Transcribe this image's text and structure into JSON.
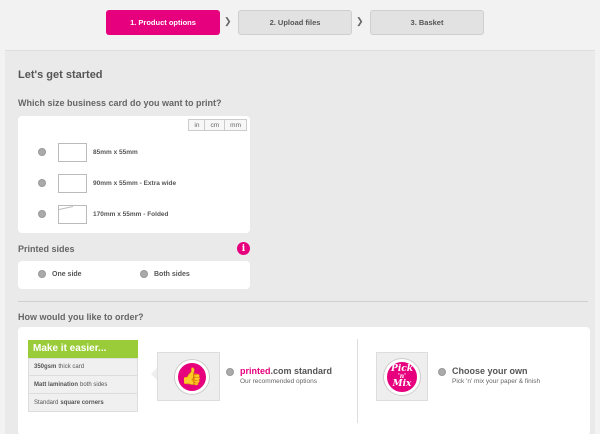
{
  "steps": [
    {
      "label": "1. Product options"
    },
    {
      "label": "2. Upload files"
    },
    {
      "label": "3. Basket"
    }
  ],
  "colors": {
    "accent": "#e6007e",
    "green": "#9acc3a"
  },
  "page": {
    "title": "Let's get started",
    "size_question": "Which size business card do you want to print?",
    "units": [
      "in",
      "cm",
      "mm"
    ],
    "sizes": [
      {
        "label": "85mm x 55mm"
      },
      {
        "label": "90mm x 55mm - Extra wide"
      },
      {
        "label": "170mm x 55mm - Folded"
      }
    ],
    "printed_sides": {
      "label": "Printed sides",
      "info_icon": "i",
      "options": [
        "One side",
        "Both sides"
      ]
    },
    "order_question": "How would you like to order?",
    "easier": {
      "heading": "Make it easier...",
      "rows": [
        {
          "bold": "350gsm",
          "text": "thick card"
        },
        {
          "bold": "Matt lamination",
          "text": "both sides"
        },
        {
          "prefix": "Standard",
          "bold": "square corners"
        }
      ]
    },
    "standard_option": {
      "icon": "thumbs-up-icon",
      "glyph": "👍",
      "brand": "printed",
      "title_rest": ".com standard",
      "subtitle": "Our recommended options"
    },
    "pick_option": {
      "logo_line1": "Pick",
      "logo_line2": "'n'",
      "logo_line3": "Mix",
      "title": "Choose your own",
      "subtitle": "Pick 'n' mix your paper & finish"
    }
  }
}
